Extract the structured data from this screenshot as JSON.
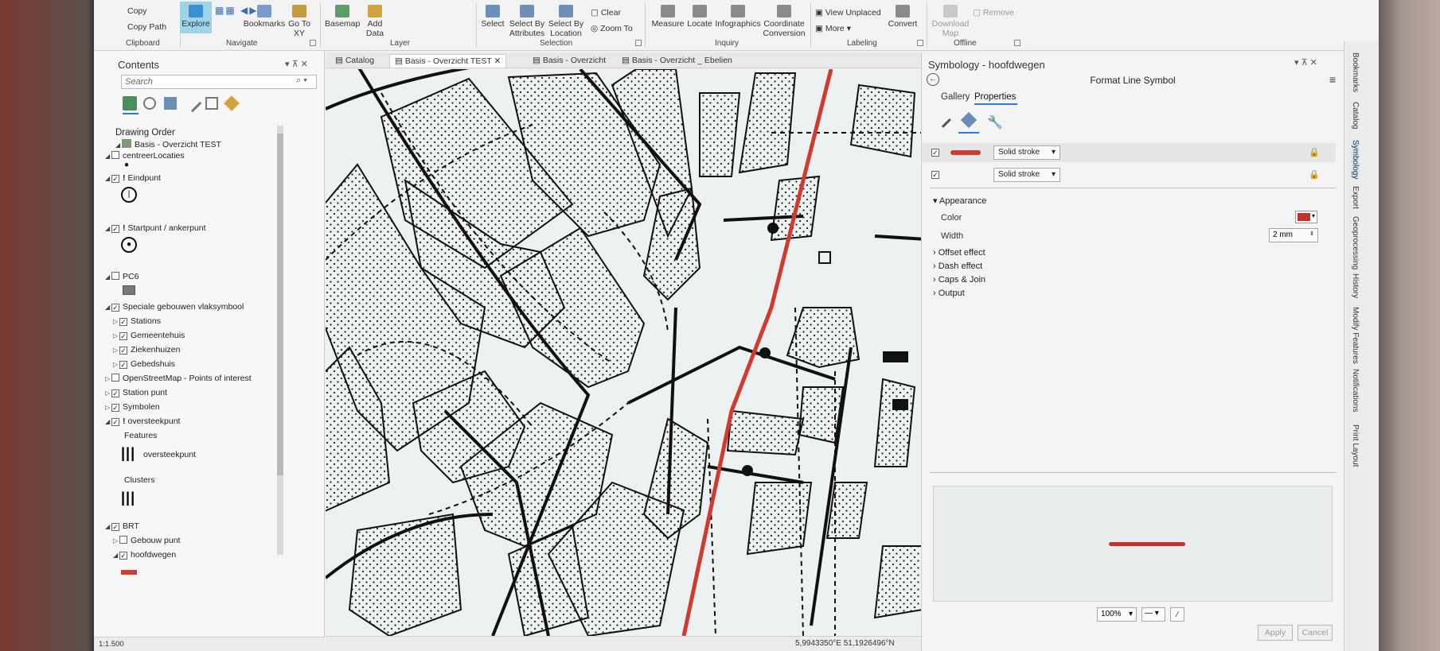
{
  "ribbon": {
    "clipboard": {
      "copy": "Copy",
      "copy_path": "Copy Path",
      "group": "Clipboard"
    },
    "navigate": {
      "explore": "Explore",
      "bookmarks": "Bookmarks",
      "goto": "Go To XY",
      "group": "Navigate"
    },
    "layer": {
      "basemap": "Basemap",
      "add_data": "Add Data",
      "group": "Layer"
    },
    "selection": {
      "select": "Select",
      "by_attributes": "Select By Attributes",
      "by_location": "Select By Location",
      "clear": "Clear",
      "zoom_to": "Zoom To",
      "group": "Selection"
    },
    "inquiry": {
      "measure": "Measure",
      "locate": "Locate",
      "infographics": "Infographics",
      "coord_conv": "Coordinate Conversion",
      "group": "Inquiry"
    },
    "labeling": {
      "view_unplaced": "View Unplaced",
      "more": "More",
      "convert": "Convert",
      "group": "Labeling"
    },
    "offline": {
      "download": "Download Map",
      "remove": "Remove",
      "group": "Offline"
    }
  },
  "contents": {
    "title": "Contents",
    "search_placeholder": "Search",
    "drawing_order": "Drawing Order",
    "map_name": "Basis - Overzicht TEST",
    "layers": [
      {
        "label": "centreerLocaties",
        "checked": false
      },
      {
        "label": "Eindpunt",
        "checked": true
      },
      {
        "label": "Startpunt / ankerpunt",
        "checked": true
      },
      {
        "label": "PC6",
        "checked": false
      },
      {
        "label": "Speciale gebouwen vlaksymbool",
        "checked": true
      },
      {
        "label": "Stations",
        "checked": true
      },
      {
        "label": "Gemeentehuis",
        "checked": true
      },
      {
        "label": "Ziekenhuizen",
        "checked": true
      },
      {
        "label": "Gebedshuis",
        "checked": true
      },
      {
        "label": "OpenStreetMap - Points of interest",
        "checked": false
      },
      {
        "label": "Station punt",
        "checked": true
      },
      {
        "label": "Symbolen",
        "checked": true
      },
      {
        "label": "oversteekpunt",
        "checked": true
      },
      {
        "label": "Features",
        "checked": null
      },
      {
        "label": "oversteekpunt",
        "checked": null
      },
      {
        "label": "Clusters",
        "checked": null
      },
      {
        "label": "BRT",
        "checked": true
      },
      {
        "label": "Gebouw punt",
        "checked": false
      },
      {
        "label": "hoofdwegen",
        "checked": true
      }
    ],
    "scale": "1:1.500"
  },
  "map_tabs": [
    "Catalog",
    "Basis - Overzicht TEST",
    "Basis - Overzicht",
    "Basis - Overzicht _ Ebelien"
  ],
  "map_status": {
    "coords": "5,9943350°E 51,1926496°N"
  },
  "symbology": {
    "title": "Symbology - hoofdwegen",
    "subtitle": "Format Line Symbol",
    "tabs": [
      "Gallery",
      "Properties"
    ],
    "layers": [
      {
        "type": "Solid stroke",
        "color": "#d23a30",
        "checked": true
      },
      {
        "type": "Solid stroke",
        "color": "",
        "checked": true
      }
    ],
    "appearance": "Appearance",
    "color_label": "Color",
    "color_value": "#c8302b",
    "width_label": "Width",
    "width_value": "2 mm",
    "sections": [
      "Offset effect",
      "Dash effect",
      "Caps & Join",
      "Output"
    ],
    "zoom": "100%",
    "apply": "Apply",
    "cancel": "Cancel"
  },
  "rail": [
    "Bookmarks",
    "Catalog",
    "Symbology",
    "Export",
    "Geoprocessing",
    "History",
    "Modify Features",
    "Notifications",
    "Print Layout"
  ],
  "colors": {
    "road": "#d23a30",
    "accent": "#2b7bd6"
  }
}
